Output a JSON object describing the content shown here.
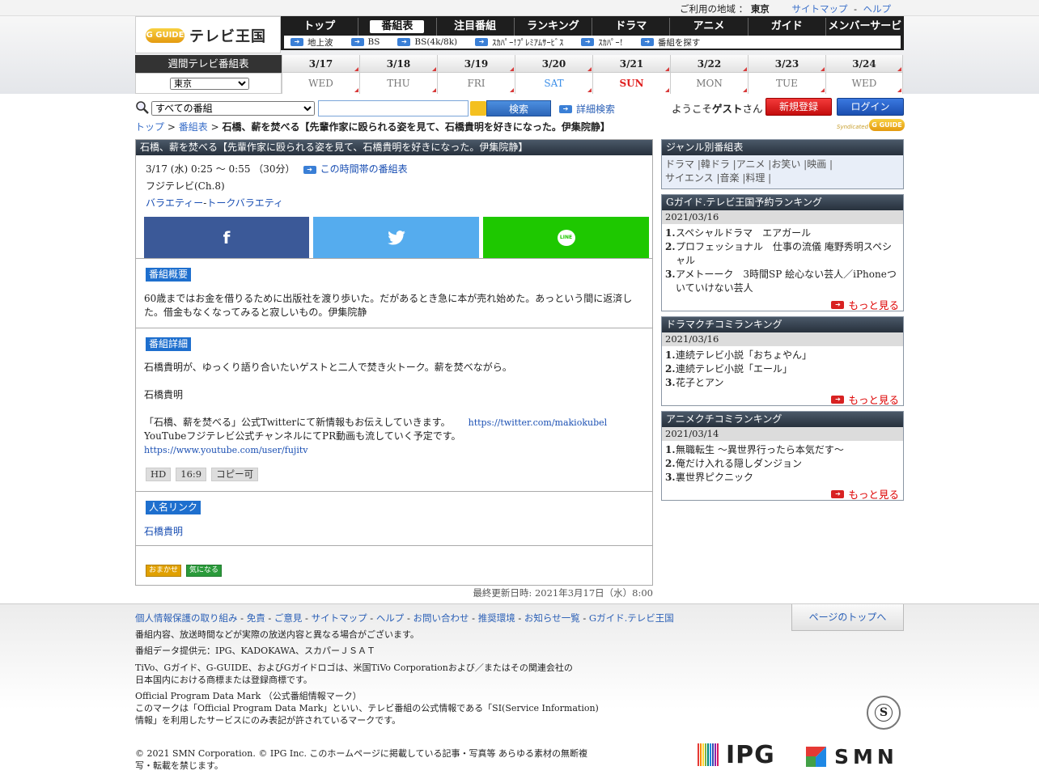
{
  "topbar": {
    "region_label": "ご利用の地域 ：",
    "region": "東京",
    "sitemap": "サイトマップ",
    "sep": "-",
    "help": "ヘルプ"
  },
  "logo": {
    "badge": "G GUIDE",
    "text": "テレビ王国"
  },
  "gnav": {
    "items": [
      {
        "label": "トップ"
      },
      {
        "label": "番組表"
      },
      {
        "label": "注目番組"
      },
      {
        "label": "ランキング"
      },
      {
        "label": "ドラマ"
      },
      {
        "label": "アニメ"
      },
      {
        "label": "ガイド"
      },
      {
        "label": "メンバーサービス"
      }
    ],
    "sub": [
      {
        "label": "地上波"
      },
      {
        "label": "BS"
      },
      {
        "label": "BS(4k/8k)"
      },
      {
        "label": "ｽｶﾊﾟｰ!ﾌﾟﾚﾐｱﾑｻｰﾋﾞｽ"
      },
      {
        "label": "ｽｶﾊﾟｰ!"
      },
      {
        "label": "番組を探す"
      }
    ]
  },
  "weekly": {
    "title": "週間テレビ番組表",
    "area": "東京",
    "days": [
      {
        "date": "3/17",
        "wd": "WED"
      },
      {
        "date": "3/18",
        "wd": "THU"
      },
      {
        "date": "3/19",
        "wd": "FRI"
      },
      {
        "date": "3/20",
        "wd": "SAT"
      },
      {
        "date": "3/21",
        "wd": "SUN"
      },
      {
        "date": "3/22",
        "wd": "MON"
      },
      {
        "date": "3/23",
        "wd": "TUE"
      },
      {
        "date": "3/24",
        "wd": "WED"
      }
    ]
  },
  "search": {
    "category": "すべての番組",
    "button": "検索",
    "advanced": "詳細検索",
    "query": ""
  },
  "user": {
    "welcome_pre": "ようこそ",
    "guest": "ゲスト",
    "welcome_post": "さん",
    "register": "新規登録",
    "login": "ログイン"
  },
  "syndicated": {
    "label": "Syndicated",
    "badge": "G GUIDE"
  },
  "breadcrumb": {
    "top": "トップ",
    "sep": ">",
    "schedule": "番組表",
    "current": "石橋、薪を焚べる【先輩作家に殴られる姿を見て、石橋貴明を好きになった。伊集院静】"
  },
  "program": {
    "header": "石橋、薪を焚べる【先輩作家に殴られる姿を見て、石橋貴明を好きになった。伊集院静】",
    "time": "3/17 (水) 0:25 ～ 0:55 （30分）",
    "timeslot_link": "この時間帯の番組表",
    "channel": "フジテレビ(Ch.8)",
    "genre1": "バラエティー",
    "genre_sep": " - ",
    "genre2": "トークバラエティ",
    "share": {
      "facebook": "f",
      "twitter": "twitter-bird",
      "line": "LINE"
    },
    "summary_tag": "番組概要",
    "summary": "60歳まではお金を借りるために出版社を渡り歩いた。だがあるとき急に本が売れ始めた。あっという間に返済した。借金もなくなってみると寂しいもの。伊集院静",
    "detail_tag": "番組詳細",
    "detail1": "石橋貴明が、ゆっくり語り合いたいゲストと二人で焚き火トーク。薪を焚べながら。",
    "detail2": "石橋貴明",
    "detail3a": "「石橋、薪を焚べる」公式Twitterにて新情報もお伝えしていきます。",
    "detail3_link1": "https://twitter.com/makiokubel",
    "detail3b": "YouTubeフジテレビ公式チャンネルにてPR動画も流していく予定です。",
    "detail3_link2": "https://www.youtube.com/user/fujitv",
    "badges": [
      "HD",
      "16:9",
      "コピー可"
    ],
    "people_tag": "人名リンク",
    "person": "石橋貴明",
    "pill1": "おまかせ",
    "pill2": "気になる"
  },
  "last_updated": "最終更新日時: 2021年3月17日（水）8:00",
  "sidebar": {
    "genre": {
      "title": "ジャンル別番組表",
      "line1": "ドラマ |韓ドラ |アニメ |お笑い |映画 |",
      "line2": "サイエンス |音楽 |料理 |"
    },
    "reserve": {
      "title": "Gガイド.テレビ王国予約ランキング",
      "date": "2021/03/16",
      "items": [
        {
          "n": "1.",
          "t": "スペシャルドラマ　エアガール"
        },
        {
          "n": "2.",
          "t": "プロフェッショナル　仕事の流儀 庵野秀明スペシャル"
        },
        {
          "n": "3.",
          "t": "アメトーーク　3時間SP 絵心ない芸人／iPhoneついていけない芸人"
        }
      ],
      "more": "もっと見る"
    },
    "drama": {
      "title": "ドラマクチコミランキング",
      "date": "2021/03/16",
      "items": [
        {
          "n": "1.",
          "t": "連続テレビ小説「おちょやん」"
        },
        {
          "n": "2.",
          "t": "連続テレビ小説「エール」"
        },
        {
          "n": "3.",
          "t": "花子とアン"
        }
      ],
      "more": "もっと見る"
    },
    "anime": {
      "title": "アニメクチコミランキング",
      "date": "2021/03/14",
      "items": [
        {
          "n": "1.",
          "t": "無職転生 ～異世界行ったら本気だす～"
        },
        {
          "n": "2.",
          "t": "俺だけ入れる隠しダンジョン"
        },
        {
          "n": "3.",
          "t": "裏世界ピクニック"
        }
      ],
      "more": "もっと見る"
    }
  },
  "footer": {
    "links": [
      "個人情報保護の取り組み",
      "免責",
      "ご意見",
      "サイトマップ",
      "ヘルプ",
      "お問い合わせ",
      "推奨環境",
      "お知らせ一覧",
      "Gガイド.テレビ王国"
    ],
    "link_sep": " - ",
    "to_top": "ページのトップへ",
    "note1": "番組内容、放送時間などが実際の放送内容と異なる場合がございます。",
    "note2": "番組データ提供元：IPG、KADOKAWA、スカパーＪＳＡＴ",
    "note3a": "TiVo、Gガイド、G-GUIDE、およびGガイドロゴは、米国TiVo Corporationおよび／またはその関連会社の",
    "note3b": "日本国内における商標または登録商標です。",
    "note4a": "Official Program Data Mark （公式番組情報マーク）",
    "note4b": "このマークは「Official Program Data Mark」といい、テレビ番組の公式情報である「SI(Service Information)",
    "note4c": "情報」を利用したサービスにのみ表記が許されているマークです。",
    "copy1": "© 2021 SMN Corporation. © IPG Inc. このホームページに掲載している記事・写真等 あらゆる素材の無断複",
    "copy2": "写・転載を禁じます。",
    "ipg": "IPG",
    "smn": "SMN",
    "smark": "S"
  }
}
